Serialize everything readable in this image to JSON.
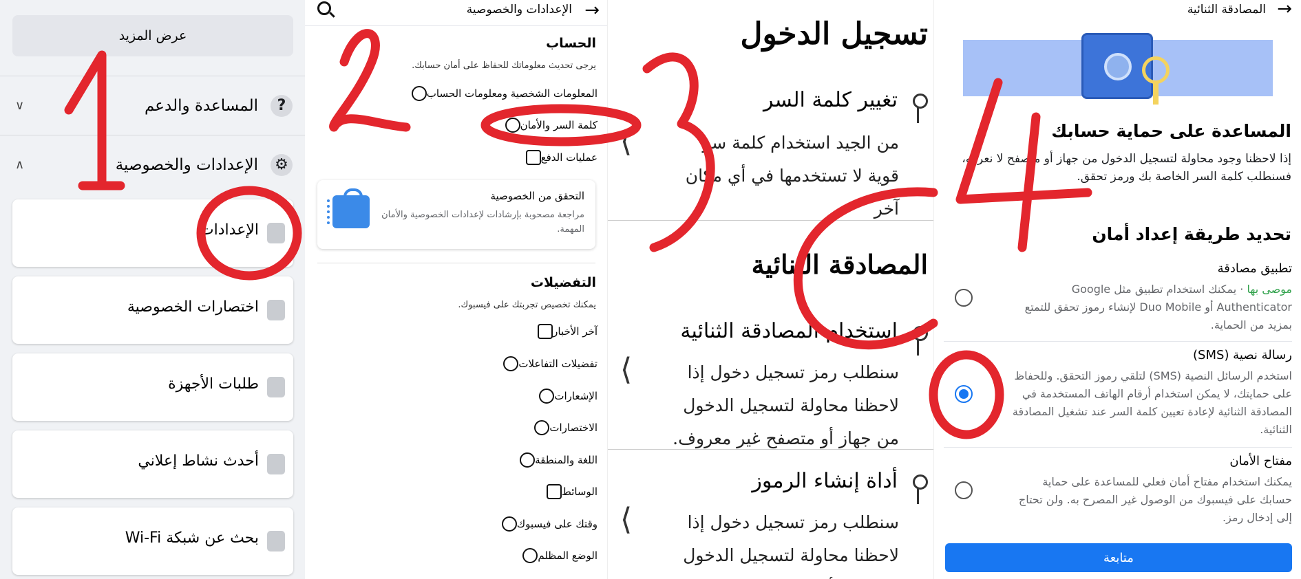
{
  "panel1": {
    "see_more": "عرض المزيد",
    "help": "المساعدة والدعم",
    "settings_privacy": "الإعدادات والخصوصية",
    "cards": [
      "الإعدادات",
      "اختصارات الخصوصية",
      "طلبات الأجهزة",
      "أحدث نشاط إعلاني",
      "بحث عن شبكة Wi-Fi"
    ]
  },
  "panel2": {
    "title": "الإعدادات والخصوصية",
    "account_title": "الحساب",
    "account_sub": "يرجى تحديث معلوماتك للحفاظ على أمان حسابك.",
    "account_items": [
      "المعلومات الشخصية ومعلومات الحساب",
      "كلمة السر والأمان",
      "عمليات الدفع"
    ],
    "privacy_check_title": "التحقق من الخصوصية",
    "privacy_check_desc": "مراجعة مصحوبة بإرشادات لإعدادات الخصوصية والأمان المهمة.",
    "prefs_title": "التفضيلات",
    "prefs_sub": "يمكنك تخصيص تجربتك على فيسبوك.",
    "pref_items": [
      "آخر الأخبار",
      "تفضيلات التفاعلات",
      "الإشعارات",
      "الاختصارات",
      "اللغة والمنطقة",
      "الوسائط",
      "وقتك على فيسبوك",
      "الوضع المظلم"
    ]
  },
  "panel3": {
    "login_title": "تسجيل الدخول",
    "change_pw": "تغيير كلمة السر",
    "change_pw_desc": "من الجيد استخدام كلمة سر قوية لا تستخدمها في أي مكان آخر",
    "two_factor_title": "المصادقة الثنائية",
    "use_2fa": "استخدام المصادقة الثنائية",
    "use_2fa_desc": "سنطلب رمز تسجيل دخول إذا لاحظنا محاولة لتسجيل الدخول من جهاز أو متصفح غير معروف.",
    "code_gen": "أداة إنشاء الرموز",
    "code_gen_desc": "سنطلب رمز تسجيل دخول إذا لاحظنا محاولة لتسجيل الدخول من جهاز أو متصفح غير معروف."
  },
  "panel4": {
    "title": "المصادقة الثنائية",
    "help_title": "المساعدة على حماية حسابك",
    "help_desc": "إذا لاحظنا وجود محاولة لتسجيل الدخول من جهاز أو متصفح لا نعرفه، فسنطلب كلمة السر الخاصة بك ورمز تحقق.",
    "choose_title": "تحديد طريقة إعداد أمان",
    "opt_app_title": "تطبيق مصادقة",
    "opt_app_rec": "موصى بها",
    "opt_app_desc": " · يمكنك استخدام تطبيق مثل Google Authenticator أو Duo Mobile لإنشاء رموز تحقق للتمتع بمزيد من الحماية.",
    "opt_sms_title": "رسالة نصية (SMS)",
    "opt_sms_desc": "استخدم الرسائل النصية (SMS) لتلقي رموز التحقق. وللحفاظ على حمايتك، لا يمكن استخدام أرقام الهاتف المستخدمة في المصادقة الثنائية لإعادة تعيين كلمة السر عند تشغيل المصادقة الثنائية.",
    "opt_key_title": "مفتاح الأمان",
    "opt_key_desc": "يمكنك استخدام مفتاح أمان فعلي للمساعدة على حماية حسابك على فيسبوك من الوصول غير المصرح به. ولن تحتاج إلى إدخال رمز.",
    "continue": "متابعة"
  },
  "colors": {
    "accent": "#1877f2",
    "annotation": "#e3262d",
    "recommended": "#31a24c"
  }
}
